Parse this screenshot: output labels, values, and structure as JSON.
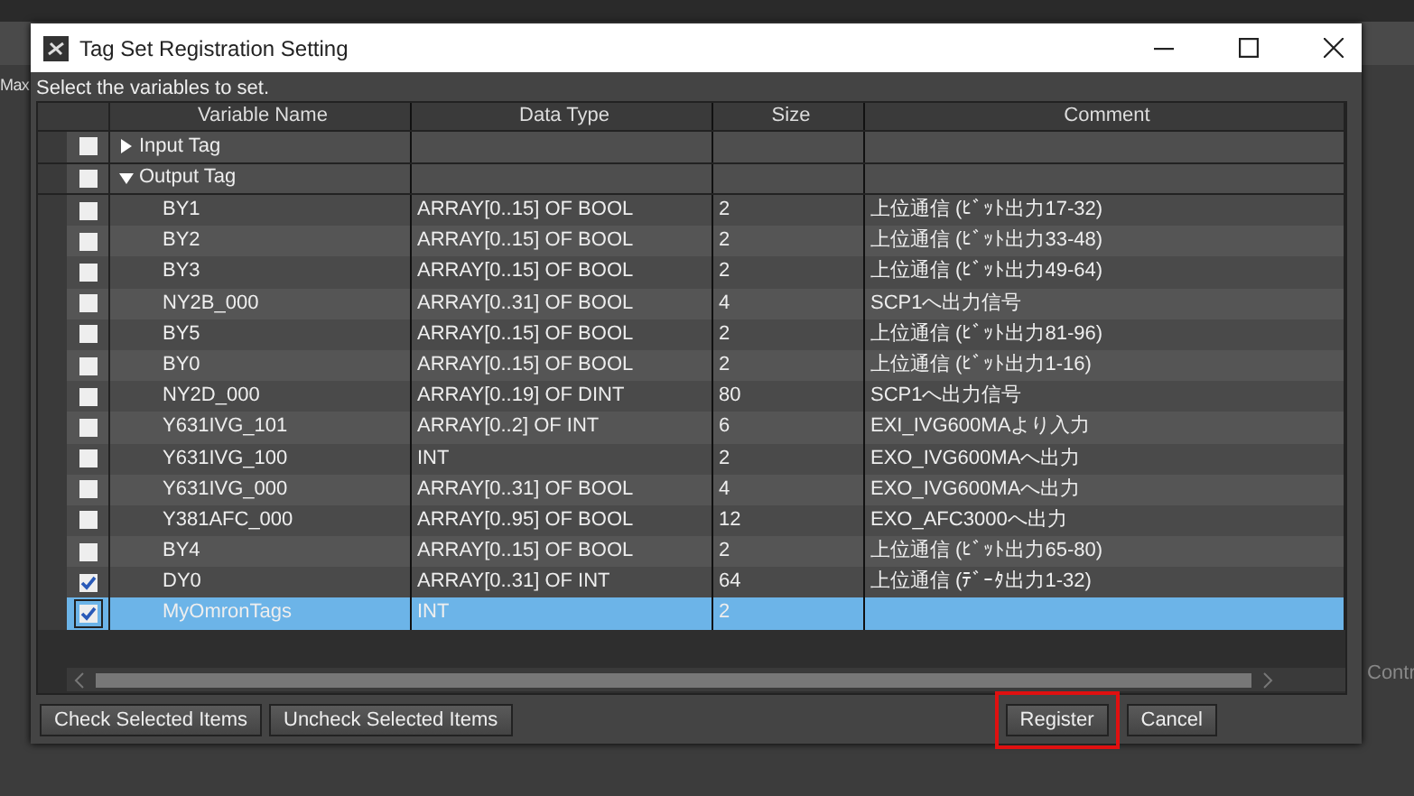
{
  "background": {
    "left_label": "Max",
    "right_label": "Contr"
  },
  "window": {
    "title": "Tag Set Registration Setting",
    "instruction": "Select the variables to set."
  },
  "table": {
    "columns": [
      "Variable Name",
      "Data Type",
      "Size",
      "Comment"
    ],
    "groups": [
      {
        "name": "Input Tag",
        "expanded": false,
        "checked": false
      },
      {
        "name": "Output Tag",
        "expanded": true,
        "checked": false,
        "children": [
          {
            "name": "BY1",
            "type": "ARRAY[0..15] OF BOOL",
            "size": "2",
            "comment": "上位通信 (ﾋﾞｯﾄ出力17-32)",
            "checked": false,
            "selected": false
          },
          {
            "name": "BY2",
            "type": "ARRAY[0..15] OF BOOL",
            "size": "2",
            "comment": "上位通信 (ﾋﾞｯﾄ出力33-48)",
            "checked": false,
            "selected": false
          },
          {
            "name": "BY3",
            "type": "ARRAY[0..15] OF BOOL",
            "size": "2",
            "comment": "上位通信 (ﾋﾞｯﾄ出力49-64)",
            "checked": false,
            "selected": false
          },
          {
            "name": "NY2B_000",
            "type": "ARRAY[0..31] OF BOOL",
            "size": "4",
            "comment": "SCP1へ出力信号",
            "checked": false,
            "selected": false
          },
          {
            "name": "BY5",
            "type": "ARRAY[0..15] OF BOOL",
            "size": "2",
            "comment": "上位通信 (ﾋﾞｯﾄ出力81-96)",
            "checked": false,
            "selected": false
          },
          {
            "name": "BY0",
            "type": "ARRAY[0..15] OF BOOL",
            "size": "2",
            "comment": "上位通信 (ﾋﾞｯﾄ出力1-16)",
            "checked": false,
            "selected": false
          },
          {
            "name": "NY2D_000",
            "type": "ARRAY[0..19] OF DINT",
            "size": "80",
            "comment": "SCP1へ出力信号",
            "checked": false,
            "selected": false
          },
          {
            "name": "Y631IVG_101",
            "type": "ARRAY[0..2] OF INT",
            "size": "6",
            "comment": "EXI_IVG600MAより入力",
            "checked": false,
            "selected": false
          },
          {
            "name": "Y631IVG_100",
            "type": "INT",
            "size": "2",
            "comment": "EXO_IVG600MAへ出力",
            "checked": false,
            "selected": false
          },
          {
            "name": "Y631IVG_000",
            "type": "ARRAY[0..31] OF BOOL",
            "size": "4",
            "comment": "EXO_IVG600MAへ出力",
            "checked": false,
            "selected": false
          },
          {
            "name": "Y381AFC_000",
            "type": "ARRAY[0..95] OF BOOL",
            "size": "12",
            "comment": "EXO_AFC3000へ出力",
            "checked": false,
            "selected": false
          },
          {
            "name": "BY4",
            "type": "ARRAY[0..15] OF BOOL",
            "size": "2",
            "comment": "上位通信 (ﾋﾞｯﾄ出力65-80)",
            "checked": false,
            "selected": false
          },
          {
            "name": "DY0",
            "type": "ARRAY[0..31] OF INT",
            "size": "64",
            "comment": "上位通信 (ﾃﾞｰﾀ出力1-32)",
            "checked": true,
            "selected": false
          },
          {
            "name": "MyOmronTags",
            "type": "INT",
            "size": "2",
            "checked": true,
            "selected": true
          }
        ]
      }
    ]
  },
  "left_buttons": [
    "Check Selected Items",
    "Uncheck Selected Items"
  ],
  "right_buttons": [
    {
      "label": "Register",
      "highlighted": true
    },
    {
      "label": "Cancel",
      "highlighted": false
    }
  ]
}
